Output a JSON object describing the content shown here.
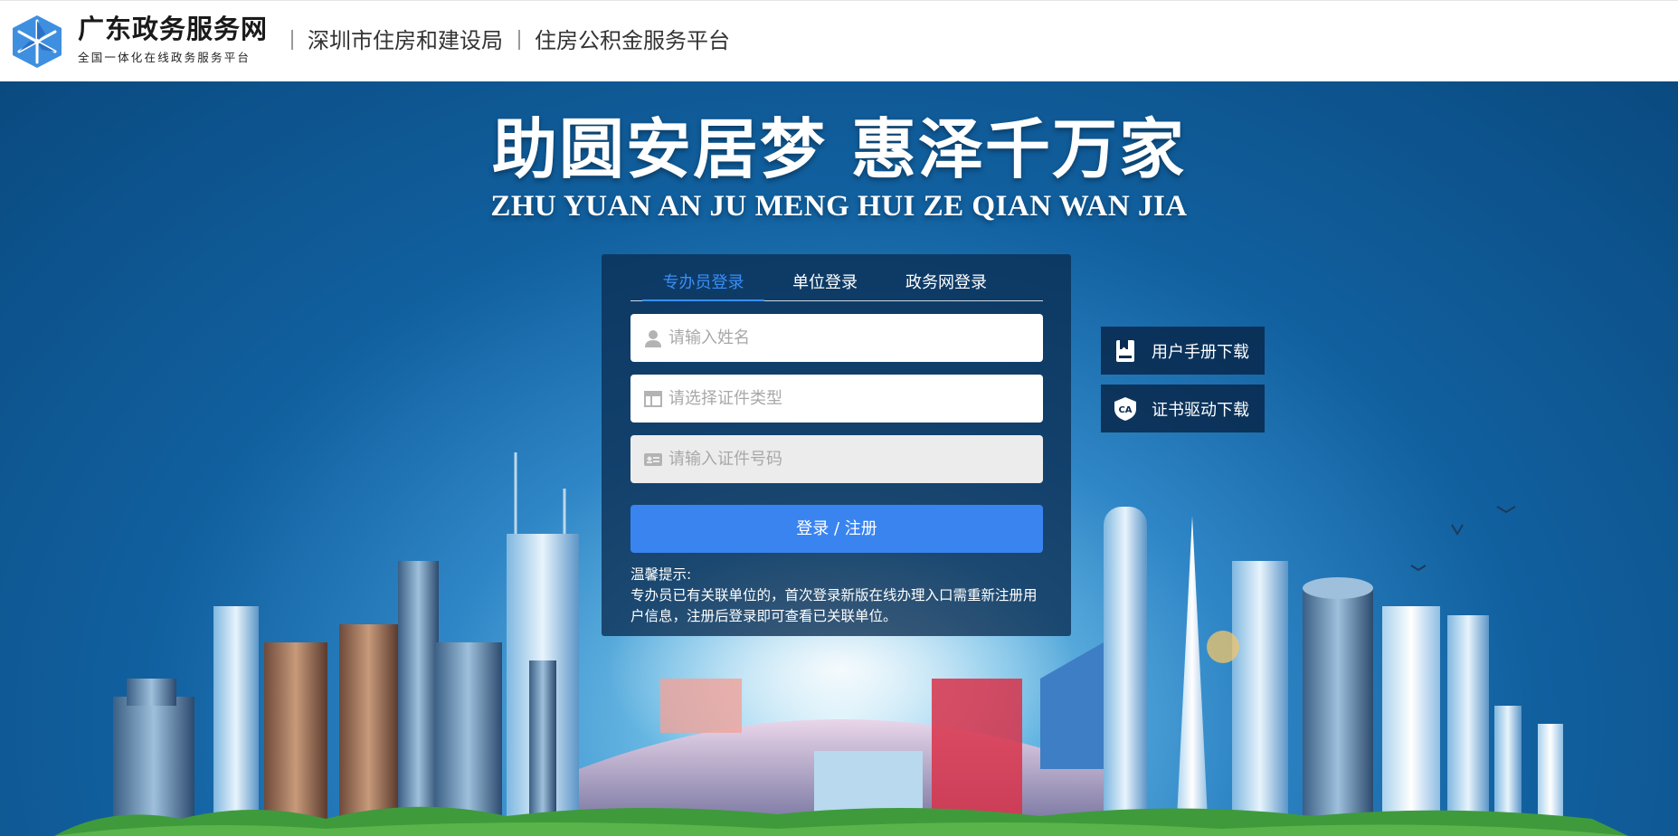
{
  "header": {
    "brand_title": "广东政务服务网",
    "brand_subtitle": "全国一体化在线政务服务平台",
    "bureau": "深圳市住房和建设局",
    "platform": "住房公积金服务平台",
    "logo_color": "#3f8fe0"
  },
  "hero": {
    "slogan_cn": "助圆安居梦 惠泽千万家",
    "slogan_en": "ZHU YUAN AN JU MENG HUI ZE QIAN WAN JIA"
  },
  "login": {
    "tabs": [
      {
        "label": "专办员登录",
        "active": true
      },
      {
        "label": "单位登录",
        "active": false
      },
      {
        "label": "政务网登录",
        "active": false
      }
    ],
    "name_placeholder": "请输入姓名",
    "cert_type_placeholder": "请选择证件类型",
    "cert_no_placeholder": "请输入证件号码",
    "submit_label": "登录 / 注册",
    "tips_title": "温馨提示:",
    "tips_body": "专办员已有关联单位的，首次登录新版在线办理入口需重新注册用户信息，注册后登录即可查看已关联单位。",
    "accent_color": "#3a84f0"
  },
  "side": {
    "manual_label": "用户手册下载",
    "driver_label": "证书驱动下载",
    "manual_icon": "book-icon",
    "driver_icon": "ca-shield-icon"
  }
}
